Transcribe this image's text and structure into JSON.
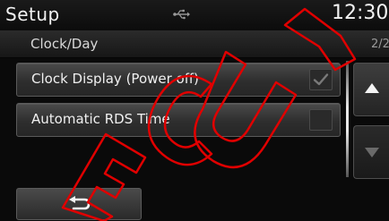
{
  "header": {
    "title": "Setup",
    "time": "12:30",
    "usb_icon": "usb-icon"
  },
  "subheader": {
    "title": "Clock/Day",
    "page": "2/2"
  },
  "options": [
    {
      "label": "Clock Display (Power off)",
      "checked": true
    },
    {
      "label": "Automatic RDS Time",
      "checked": false
    }
  ],
  "controls": {
    "scroll_up_icon": "arrow-up-icon",
    "scroll_down_icon": "arrow-down-icon",
    "back_icon": "back-arrow-icon"
  },
  "watermark": {
    "text": "ECU",
    "color": "#e00000"
  },
  "colors": {
    "background": "#0a0a0a",
    "text": "#f0f0f0"
  }
}
